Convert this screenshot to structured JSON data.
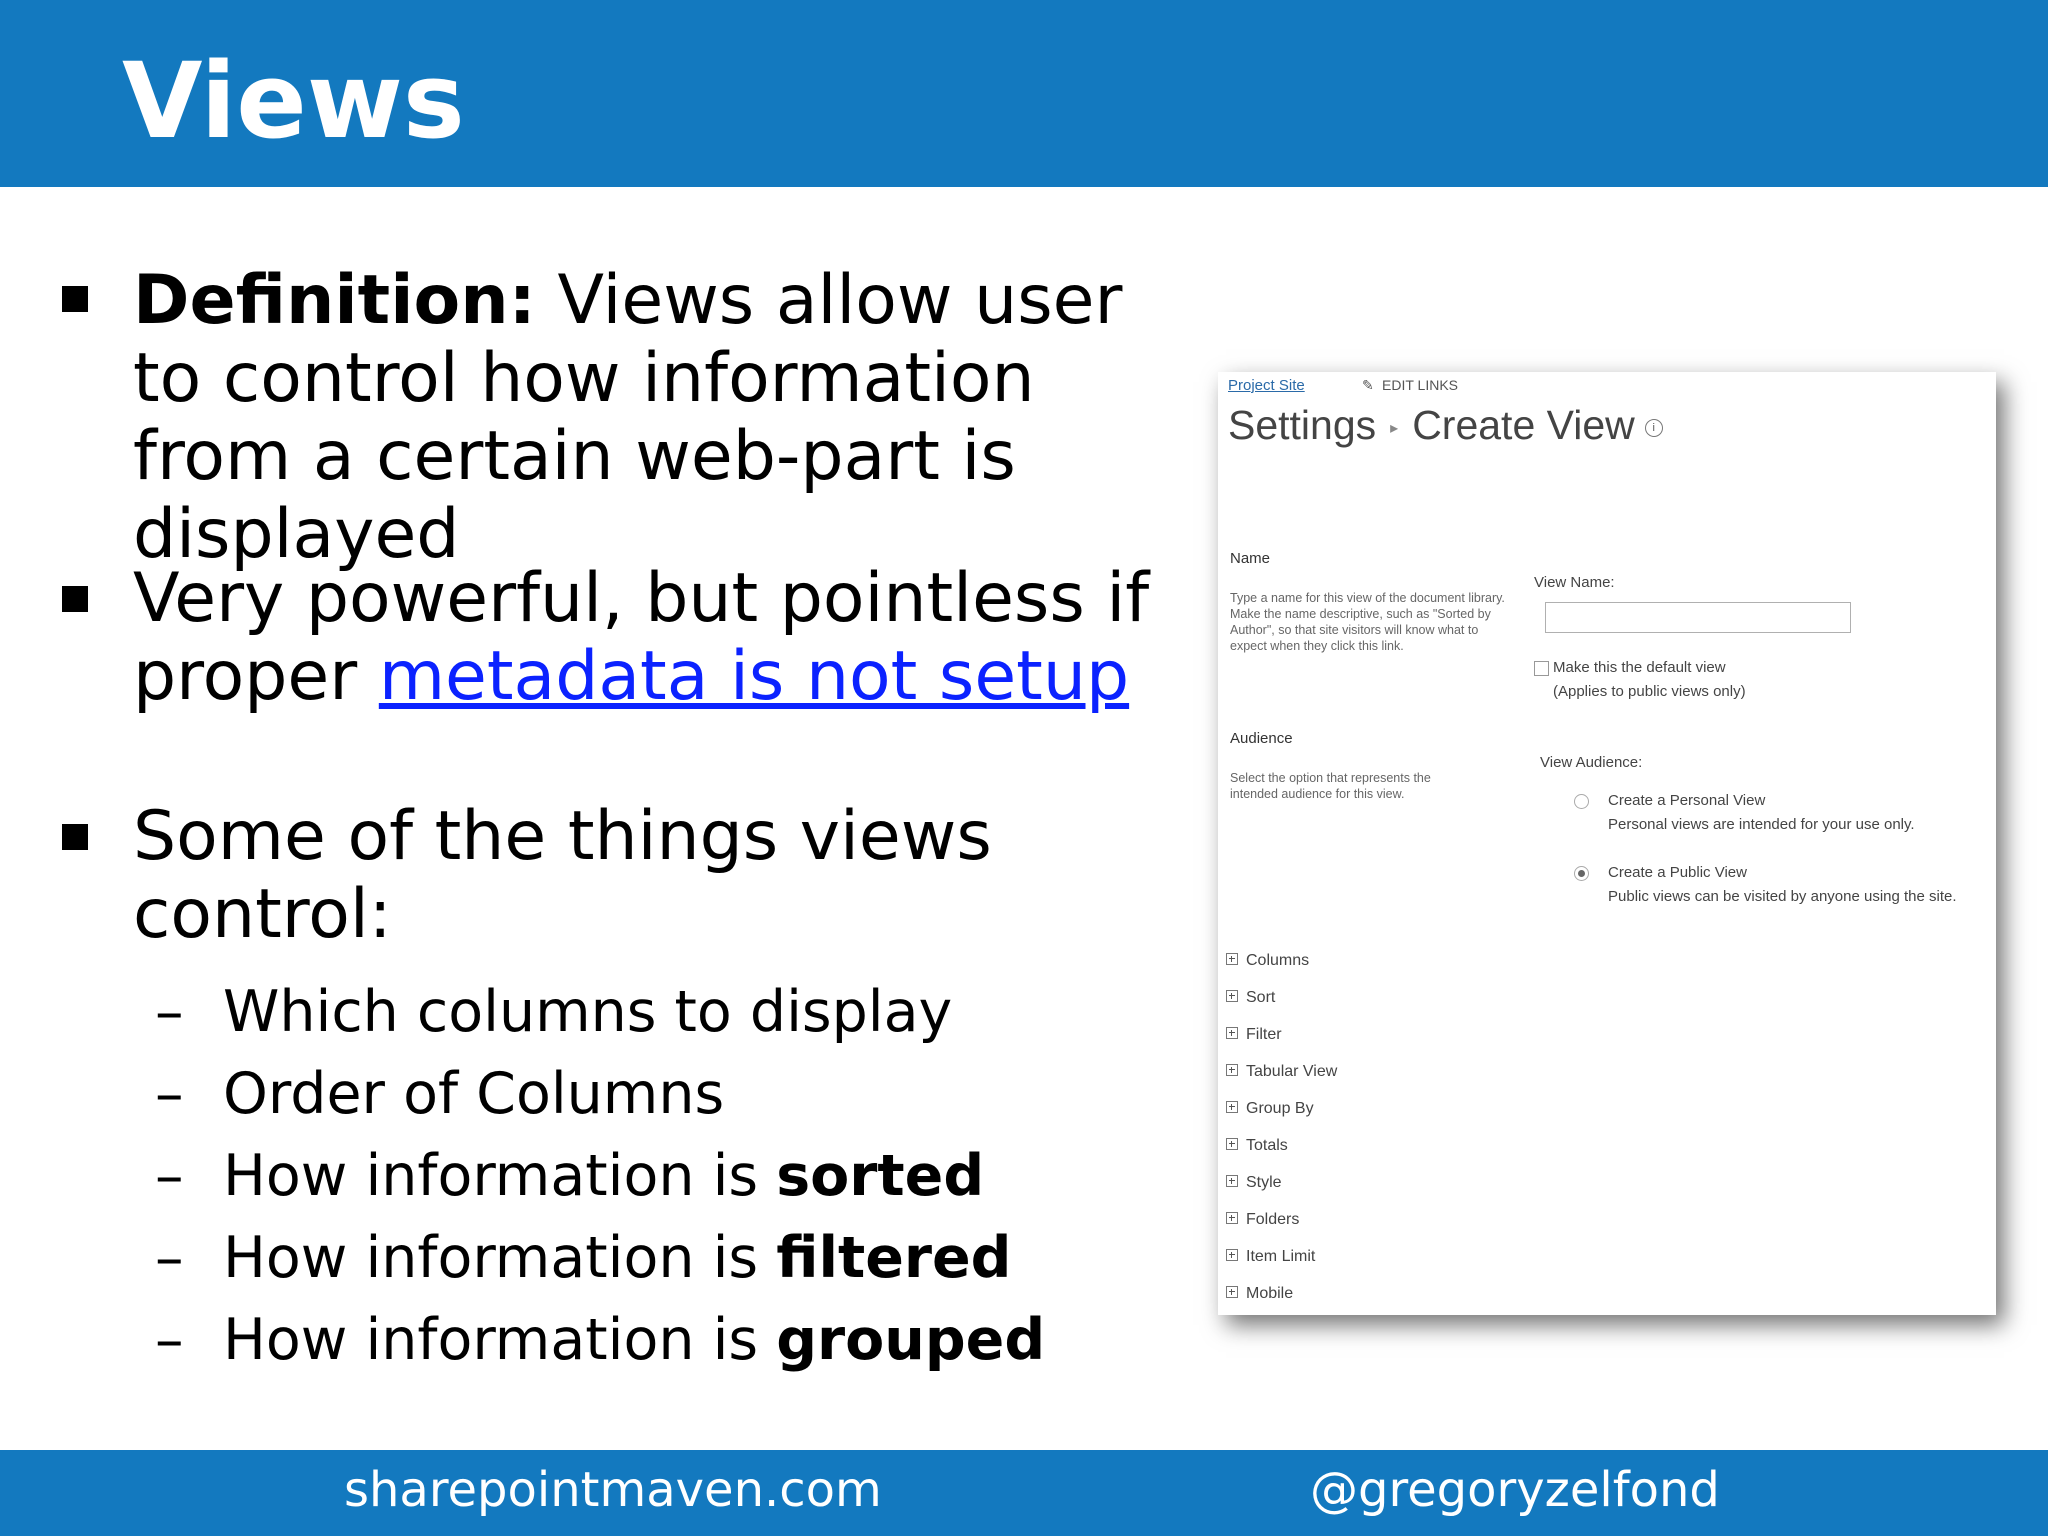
{
  "slide": {
    "title": "Views",
    "footer_left": "sharepointmaven.com",
    "footer_right": "@gregoryzelfond",
    "bullets": [
      {
        "bold_prefix": "Definition:",
        "text": " Views allow user to control how information from a certain web-part is displayed"
      },
      {
        "text_before": "Very powerful, but pointless if proper ",
        "link": "metadata is not setup"
      },
      {
        "text": "Some of the things views control:"
      }
    ],
    "sub_bullets": [
      {
        "dash": "–",
        "text": "Which columns to display",
        "bold": ""
      },
      {
        "dash": "–",
        "text": "Order of Columns",
        "bold": ""
      },
      {
        "dash": "–",
        "text": "How information is ",
        "bold": "sorted"
      },
      {
        "dash": "–",
        "text": "How information is ",
        "bold": "filtered"
      },
      {
        "dash": "–",
        "text": "How information is ",
        "bold": "grouped"
      }
    ]
  },
  "screenshot": {
    "breadcrumb": "Project Site",
    "edit_links": "EDIT LINKS",
    "title_part1": "Settings",
    "title_sep": "▸",
    "title_part2": "Create View",
    "name_section": {
      "title": "Name",
      "description": "Type a name for this view of the document library. Make the name descriptive, such as \"Sorted by Author\", so that site visitors will know what to expect when they click this link.",
      "view_name_label": "View Name:",
      "view_name_value": "",
      "default_checkbox_label": "Make this the default view",
      "default_checkbox_note": "(Applies to public views only)"
    },
    "audience_section": {
      "title": "Audience",
      "description": "Select the option that represents the intended audience for this view.",
      "label": "View Audience:",
      "options": [
        {
          "label": "Create a Personal View",
          "note": "Personal views are intended for your use only.",
          "selected": false
        },
        {
          "label": "Create a Public View",
          "note": "Public views can be visited by anyone using the site.",
          "selected": true
        }
      ]
    },
    "sections": [
      "Columns",
      "Sort",
      "Filter",
      "Tabular View",
      "Group By",
      "Totals",
      "Style",
      "Folders",
      "Item Limit",
      "Mobile"
    ]
  }
}
